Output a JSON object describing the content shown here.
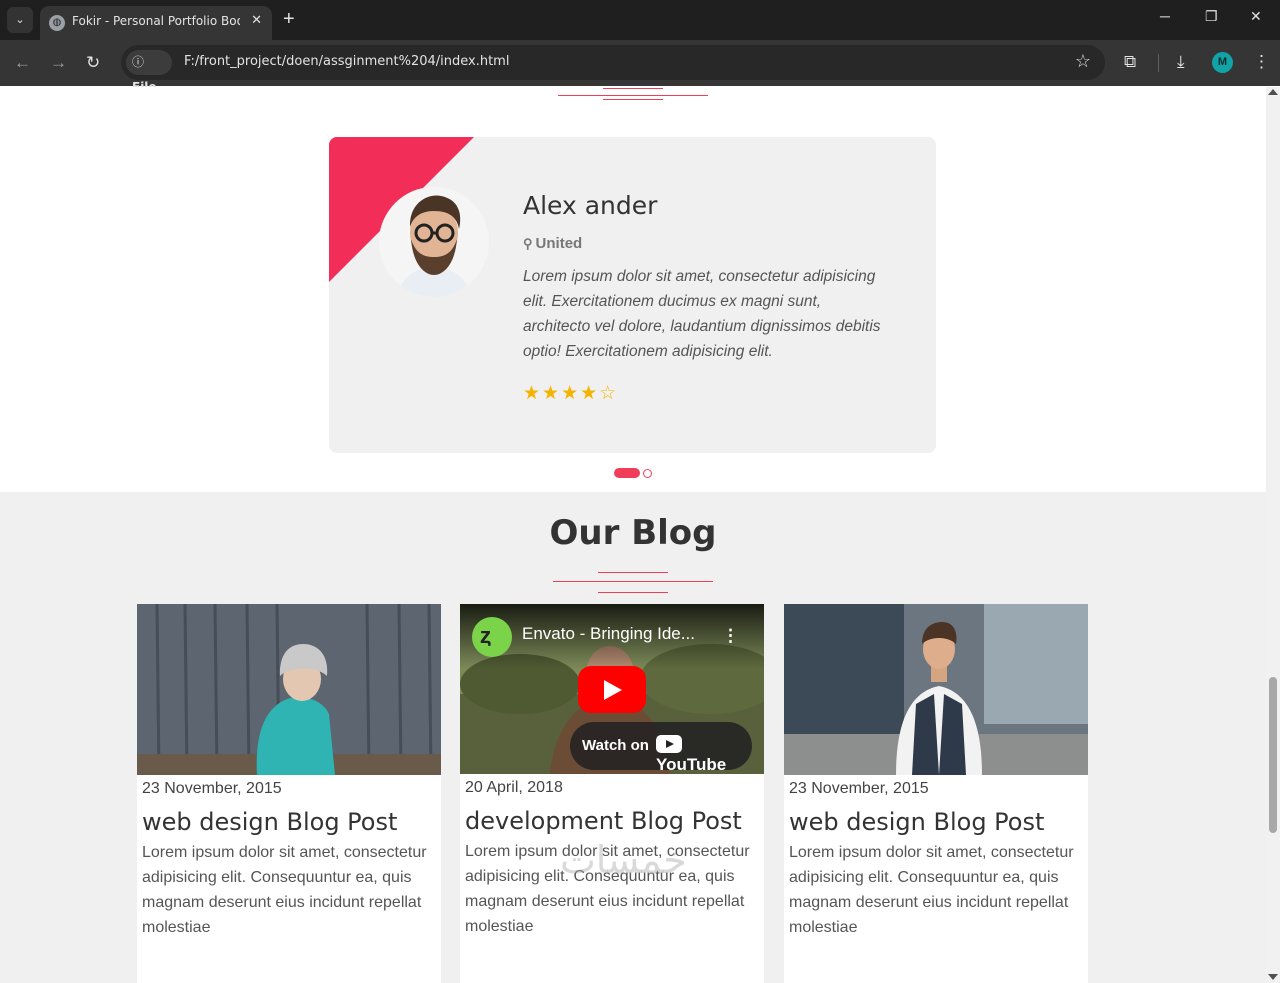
{
  "browser": {
    "tab_title": "Fokir - Personal Portfolio Bootst",
    "url_chip": "File",
    "url": "F:/front_project/doen/assginment%204/index.html",
    "profile_initial": "M"
  },
  "testimonial": {
    "name": "Alex ander",
    "location": "United",
    "text": "Lorem ipsum dolor sit amet, consectetur adipisicing elit. Exercitationem ducimus ex magni sunt, architecto vel dolore, laudantium dignissimos debitis optio! Exercitationem adipisicing elit.",
    "rating": 4,
    "rating_max": 5,
    "stars": "★★★★☆",
    "slider_pages": 2,
    "slider_active": 1
  },
  "blog": {
    "title": "Our Blog",
    "posts": [
      {
        "date": "23 November, 2015",
        "title": "web design Blog Post",
        "excerpt": "Lorem ipsum dolor sit amet, consectetur adipisicing elit. Consequuntur ea, quis magnam deserunt eius incidunt repellat molestiae"
      },
      {
        "date": "20 April, 2018",
        "title": "development Blog Post",
        "excerpt": "Lorem ipsum dolor sit amet, consectetur adipisicing elit. Consequuntur ea, quis magnam deserunt eius incidunt repellat molestiae",
        "video": {
          "title": "Envato - Bringing Ide...",
          "watch_on": "Watch on",
          "brand": "YouTube"
        }
      },
      {
        "date": "23 November, 2015",
        "title": "web design Blog Post",
        "excerpt": "Lorem ipsum dolor sit amet, consectetur adipisicing elit. Consequuntur ea, quis magnam deserunt eius incidunt repellat molestiae"
      }
    ]
  },
  "watermark": "خمسات",
  "colors": {
    "accent": "#f03d5a",
    "star": "#f5b301",
    "youtube_red": "#ff0000"
  },
  "icons": {
    "tab_list": "chevron-down-icon",
    "favicon": "globe-icon",
    "close": "close-icon",
    "new_tab": "plus-icon",
    "back": "arrow-left-icon",
    "forward": "arrow-right-icon",
    "reload": "reload-icon",
    "info": "info-icon",
    "bookmark": "star-icon",
    "extensions": "puzzle-icon",
    "download": "download-icon",
    "menu": "kebab-menu-icon",
    "location": "map-marker-icon"
  }
}
